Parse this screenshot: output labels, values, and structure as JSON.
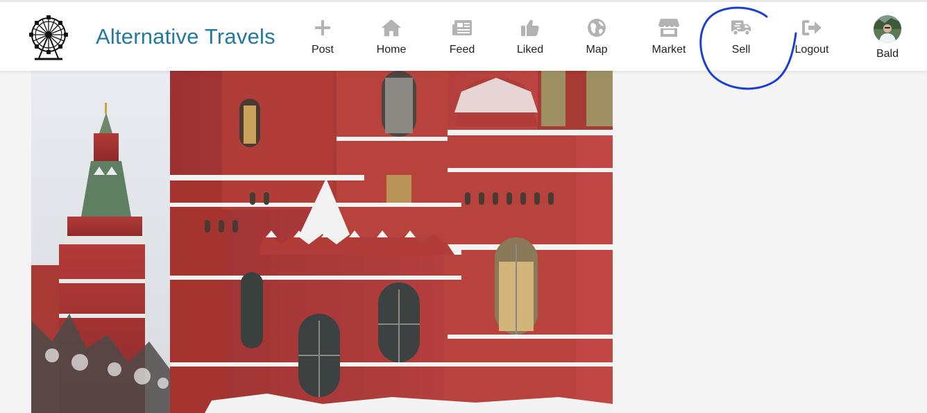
{
  "app": {
    "brand_name": "Alternative Travels",
    "brand_color": "#2279a2"
  },
  "nav": {
    "items": [
      {
        "id": "post",
        "label": "Post",
        "icon": "plus-icon"
      },
      {
        "id": "home",
        "label": "Home",
        "icon": "home-icon"
      },
      {
        "id": "feed",
        "label": "Feed",
        "icon": "newspaper-icon"
      },
      {
        "id": "liked",
        "label": "Liked",
        "icon": "thumbs-up-icon"
      },
      {
        "id": "map",
        "label": "Map",
        "icon": "globe-icon"
      },
      {
        "id": "market",
        "label": "Market",
        "icon": "store-icon"
      },
      {
        "id": "sell",
        "label": "Sell",
        "icon": "truck-icon"
      },
      {
        "id": "logout",
        "label": "Logout",
        "icon": "sign-out-icon"
      },
      {
        "id": "profile",
        "label": "Bald",
        "icon": "avatar"
      }
    ],
    "icon_color": "#b3b3b3"
  },
  "main": {
    "photo_subject": "State Historical Museum and Kremlin tower in snow"
  },
  "annotation": {
    "color": "#1a3fd6",
    "target": "Sell"
  }
}
